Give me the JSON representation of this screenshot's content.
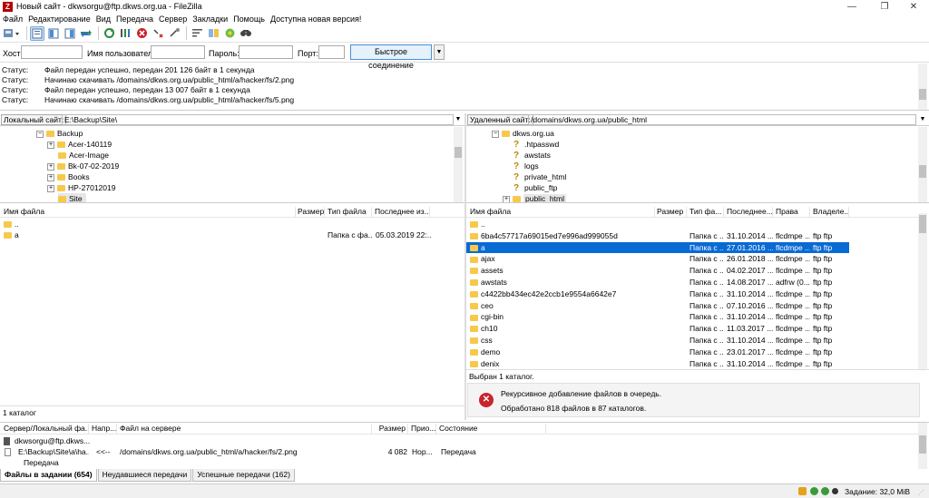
{
  "window": {
    "title": "Новый сайт - dkwsorgu@ftp.dkws.org.ua - FileZilla",
    "min": "—",
    "max": "❐",
    "close": "✕"
  },
  "menu": [
    "Файл",
    "Редактирование",
    "Вид",
    "Передача",
    "Сервер",
    "Закладки",
    "Помощь",
    "Доступна новая версия!"
  ],
  "quickconnect": {
    "host_label": "Хост:",
    "host_value": "",
    "user_label": "Имя пользователя",
    "user_value": "",
    "pass_label": "Пароль:",
    "pass_value": "",
    "port_label": "Порт:",
    "port_value": "",
    "button": "Быстрое соединение",
    "dropdown": "▼"
  },
  "log": [
    {
      "label": "Статус:",
      "text": "Файл передан успешно, передан 201 126 байт в 1 секунда"
    },
    {
      "label": "Статус:",
      "text": "Начинаю скачивать /domains/dkws.org.ua/public_html/a/hacker/fs/2.png"
    },
    {
      "label": "Статус:",
      "text": "Файл передан успешно, передан 13 007 байт в 1 секунда"
    },
    {
      "label": "Статус:",
      "text": "Начинаю скачивать /domains/dkws.org.ua/public_html/a/hacker/fs/5.png"
    }
  ],
  "local": {
    "site_label": "Локальный сайт:",
    "path": "E:\\Backup\\Site\\",
    "tree": [
      {
        "name": "Backup",
        "exp": "−"
      },
      {
        "name": "Acer-140119",
        "exp": "+"
      },
      {
        "name": "Acer-Image",
        "exp": ""
      },
      {
        "name": "Bk-07-02-2019",
        "exp": "+"
      },
      {
        "name": "Books",
        "exp": "+"
      },
      {
        "name": "HP-27012019",
        "exp": "+"
      },
      {
        "name": "Site",
        "exp": ""
      }
    ],
    "columns": [
      "Имя файла",
      "Размер",
      "Тип файла",
      "Последнее из..."
    ],
    "rows": [
      {
        "name": "..",
        "size": "",
        "type": "",
        "modified": ""
      },
      {
        "name": "a",
        "size": "",
        "type": "Папка с фа...",
        "modified": "05.03.2019 22:..."
      }
    ],
    "status": "1 каталог"
  },
  "remote": {
    "site_label": "Удаленный сайт:",
    "path": "/domains/dkws.org.ua/public_html",
    "tree": [
      {
        "name": "dkws.org.ua",
        "kind": "folder",
        "exp": "−"
      },
      {
        "name": ".htpasswd",
        "kind": "q",
        "exp": ""
      },
      {
        "name": "awstats",
        "kind": "q",
        "exp": ""
      },
      {
        "name": "logs",
        "kind": "q",
        "exp": ""
      },
      {
        "name": "private_html",
        "kind": "q",
        "exp": ""
      },
      {
        "name": "public_ftp",
        "kind": "q",
        "exp": ""
      },
      {
        "name": "public_html",
        "kind": "folder",
        "exp": "+"
      }
    ],
    "columns": [
      "Имя файла",
      "Размер",
      "Тип фа...",
      "Последнее...",
      "Права",
      "Владеле..."
    ],
    "rows": [
      {
        "name": "..",
        "size": "",
        "type": "",
        "modified": "",
        "perms": "",
        "owner": ""
      },
      {
        "name": "6ba4c57717a69015ed7e996ad999055d",
        "size": "",
        "type": "Папка с ...",
        "modified": "31.10.2014 ...",
        "perms": "flcdmpe ...",
        "owner": "ftp ftp"
      },
      {
        "name": "a",
        "size": "",
        "type": "Папка с ...",
        "modified": "27.01.2016 ...",
        "perms": "flcdmpe ...",
        "owner": "ftp ftp"
      },
      {
        "name": "ajax",
        "size": "",
        "type": "Папка с ...",
        "modified": "26.01.2018 ...",
        "perms": "flcdmpe ...",
        "owner": "ftp ftp"
      },
      {
        "name": "assets",
        "size": "",
        "type": "Папка с ...",
        "modified": "04.02.2017 ...",
        "perms": "flcdmpe ...",
        "owner": "ftp ftp"
      },
      {
        "name": "awstats",
        "size": "",
        "type": "Папка с ...",
        "modified": "14.08.2017 ...",
        "perms": "adfrw (0...",
        "owner": "ftp ftp"
      },
      {
        "name": "c4422bb434ec42e2ccb1e9554a6642e7",
        "size": "",
        "type": "Папка с ...",
        "modified": "31.10.2014 ...",
        "perms": "flcdmpe ...",
        "owner": "ftp ftp"
      },
      {
        "name": "ceo",
        "size": "",
        "type": "Папка с ...",
        "modified": "07.10.2016 ...",
        "perms": "flcdmpe ...",
        "owner": "ftp ftp"
      },
      {
        "name": "cgi-bin",
        "size": "",
        "type": "Папка с ...",
        "modified": "31.10.2014 ...",
        "perms": "flcdmpe ...",
        "owner": "ftp ftp"
      },
      {
        "name": "ch10",
        "size": "",
        "type": "Папка с ...",
        "modified": "11.03.2017 ...",
        "perms": "flcdmpe ...",
        "owner": "ftp ftp"
      },
      {
        "name": "css",
        "size": "",
        "type": "Папка с ...",
        "modified": "31.10.2014 ...",
        "perms": "flcdmpe ...",
        "owner": "ftp ftp"
      },
      {
        "name": "demo",
        "size": "",
        "type": "Папка с ...",
        "modified": "23.01.2017 ...",
        "perms": "flcdmpe ...",
        "owner": "ftp ftp"
      },
      {
        "name": "denix",
        "size": "",
        "type": "Папка с ...",
        "modified": "31.10.2014 ...",
        "perms": "flcdmpe ...",
        "owner": "ftp ftp"
      }
    ],
    "selected_index": 2,
    "status": "Выбран 1 каталог.",
    "message_line1": "Рекурсивное добавление файлов в очередь.",
    "message_line2": "Обработано 818 файлов в 87 каталогов."
  },
  "queue": {
    "columns": [
      "Сервер/Локальный фа...",
      "Напр...",
      "Файл на сервере",
      "Размер",
      "Прио...",
      "Состояние"
    ],
    "server": "dkwsorgu@ftp.dkws...",
    "item": {
      "local": "E:\\Backup\\Site\\a\\ha...",
      "dir": "<<--",
      "remote": "/domains/dkws.org.ua/public_html/a/hacker/fs/2.png",
      "size": "4 082",
      "prio": "Нор...",
      "state": "Передача"
    },
    "sub": "Передача"
  },
  "tabs": [
    "Файлы в задании (654)",
    "Неудавшиеся передачи",
    "Успешные передачи (162)"
  ],
  "statusbar": {
    "queue": "Задание: 32,0 MiB"
  },
  "colors": {
    "selected": "#0a6ad4",
    "folder": "#f6c94d",
    "error": "#c8252c",
    "accent_border": "#4a90d9"
  }
}
